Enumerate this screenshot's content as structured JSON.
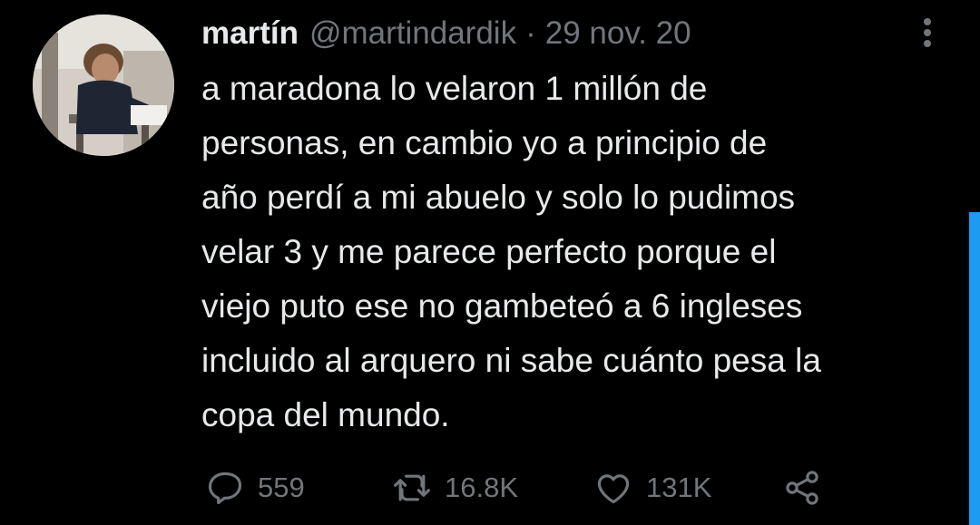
{
  "tweet": {
    "author_name": "martín",
    "handle": "@martindardik",
    "separator": "·",
    "date": "29 nov. 20",
    "text_lines": [
      "a maradona lo velaron 1 millón de",
      "personas, en cambio yo a principio de",
      "año perdí a mi abuelo y solo lo pudimos",
      "velar 3 y me parece perfecto porque el",
      "viejo puto ese no gambeteó a 6 ingleses",
      "incluido al arquero ni sabe cuánto pesa la",
      "copa del mundo."
    ],
    "replies": "559",
    "retweets": "16.8K",
    "likes": "131K"
  },
  "icons": {
    "reply": "reply-icon",
    "retweet": "retweet-icon",
    "like": "heart-icon",
    "share": "share-icon",
    "more": "more-vertical-icon"
  },
  "colors": {
    "background": "#000000",
    "text_primary": "#e7e9ea",
    "text_secondary": "#71767b",
    "scrollbar": "#1d9bf0"
  }
}
